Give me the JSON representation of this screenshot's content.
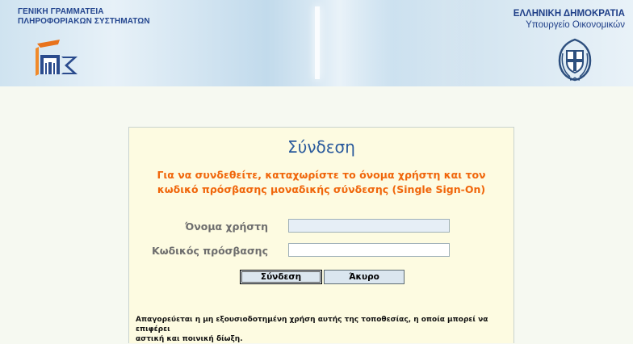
{
  "header": {
    "gsis_title_line1": "ΓΕΝΙΚΗ ΓΡΑΜΜΑΤΕΙΑ",
    "gsis_title_line2": "ΠΛΗΡΟΦΟΡΙΑΚΩΝ ΣΥΣΤΗΜΑΤΩΝ",
    "republic_title": "ΕΛΛΗΝΙΚΗ ΔΗΜΟΚΡΑΤΙΑ",
    "ministry_title": "Υπουργείο Οικονομικών",
    "gsis_logo_icon": "gsis-logo-icon",
    "emblem_icon": "greek-coat-of-arms-icon"
  },
  "login": {
    "heading": "Σύνδεση",
    "intro_line1": "Για να συνδεθείτε, καταχωρίστε το όνομα χρήστη και τον",
    "intro_line2": "κωδικό πρόσβασης μοναδικής σύνδεσης (Single Sign-On)",
    "username_label": "Όνομα χρήστη",
    "username_value": "",
    "password_label": "Κωδικός πρόσβασης",
    "password_value": "",
    "submit_label": "Σύνδεση",
    "cancel_label": "Άκυρο",
    "warning_line1": "Απαγορεύεται η μη εξουσιοδοτημένη χρήση αυτής της τοποθεσίας, η οποία μπορεί να επιφέρει",
    "warning_line2": "αστική και ποινική δίωξη."
  },
  "colors": {
    "heading": "#2a5a9c",
    "intro": "#f0660b",
    "label": "#6e6e6e",
    "box_background": "#fdfbe1",
    "page_background": "#f6f9f1",
    "header_text": "#1f3f88"
  }
}
